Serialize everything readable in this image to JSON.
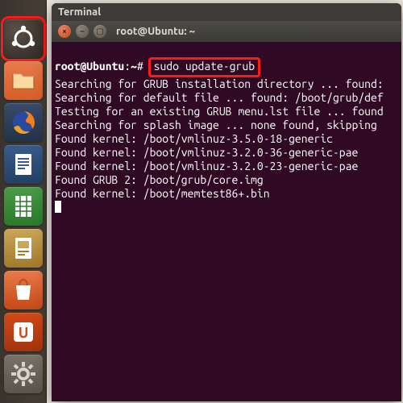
{
  "launcher": {
    "items": [
      {
        "name": "dash",
        "label": "Dash Home",
        "highlighted": true
      },
      {
        "name": "files",
        "label": "Files"
      },
      {
        "name": "firefox",
        "label": "Firefox Web Browser"
      },
      {
        "name": "writer",
        "label": "LibreOffice Writer"
      },
      {
        "name": "calc",
        "label": "LibreOffice Calc"
      },
      {
        "name": "impress",
        "label": "LibreOffice Impress"
      },
      {
        "name": "software",
        "label": "Ubuntu Software Center"
      },
      {
        "name": "ubuntuone",
        "label": "Ubuntu One"
      },
      {
        "name": "settings",
        "label": "System Settings"
      }
    ]
  },
  "window": {
    "menubar_app": "Terminal",
    "title": "root@Ubuntu: ~",
    "buttons": {
      "close": "×",
      "min": "–",
      "max": "▢"
    }
  },
  "terminal": {
    "prompt": {
      "user_host": "root@Ubuntu",
      "sep": ":",
      "cwd": "~",
      "sigil": "#"
    },
    "command": "sudo update-grub",
    "cmd_highlighted": true,
    "output": [
      "Searching for GRUB installation directory ... found:",
      "Searching for default file ... found: /boot/grub/def",
      "Testing for an existing GRUB menu.lst file ... found",
      "Searching for splash image ... none found, skipping ",
      "Found kernel: /boot/vmlinuz-3.5.0-18-generic",
      "Found kernel: /boot/vmlinuz-3.2.0-36-generic-pae",
      "Found kernel: /boot/vmlinuz-3.2.0-23-generic-pae",
      "Found GRUB 2: /boot/grub/core.img",
      "Found kernel: /boot/memtest86+.bin"
    ]
  }
}
